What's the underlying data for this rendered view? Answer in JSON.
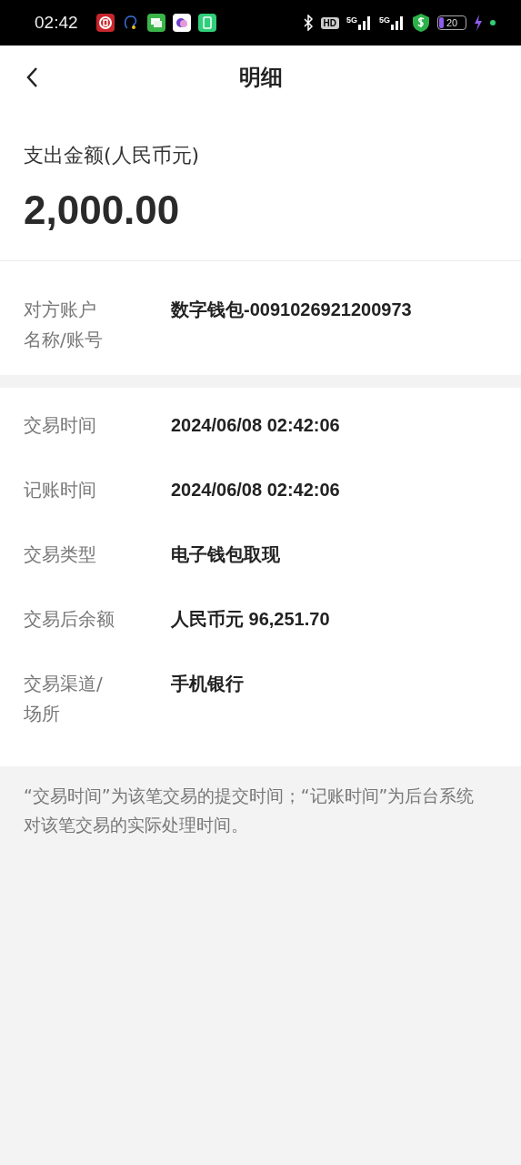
{
  "status_bar": {
    "time": "02:42",
    "hd": "HD",
    "signals": [
      "5G",
      "5G"
    ],
    "battery": "20"
  },
  "header": {
    "title": "明细"
  },
  "amount": {
    "label": "支出金额(人民币元)",
    "value": "2,000.00"
  },
  "counterparty": {
    "label_lines": [
      "对方账户",
      "名称/账号"
    ],
    "value": "数字钱包-0091026921200973"
  },
  "details": [
    {
      "label_lines": [
        "交易时间"
      ],
      "value": "2024/06/08 02:42:06"
    },
    {
      "label_lines": [
        "记账时间"
      ],
      "value": "2024/06/08 02:42:06"
    },
    {
      "label_lines": [
        "交易类型"
      ],
      "value": "电子钱包取现"
    },
    {
      "label_lines": [
        "交易后余额"
      ],
      "value": "人民币元 96,251.70"
    },
    {
      "label_lines": [
        "交易渠道/",
        "场所"
      ],
      "value": "手机银行"
    }
  ],
  "note": "“交易时间”为该笔交易的提交时间；“记账时间”为后台系统对该笔交易的实际处理时间。"
}
